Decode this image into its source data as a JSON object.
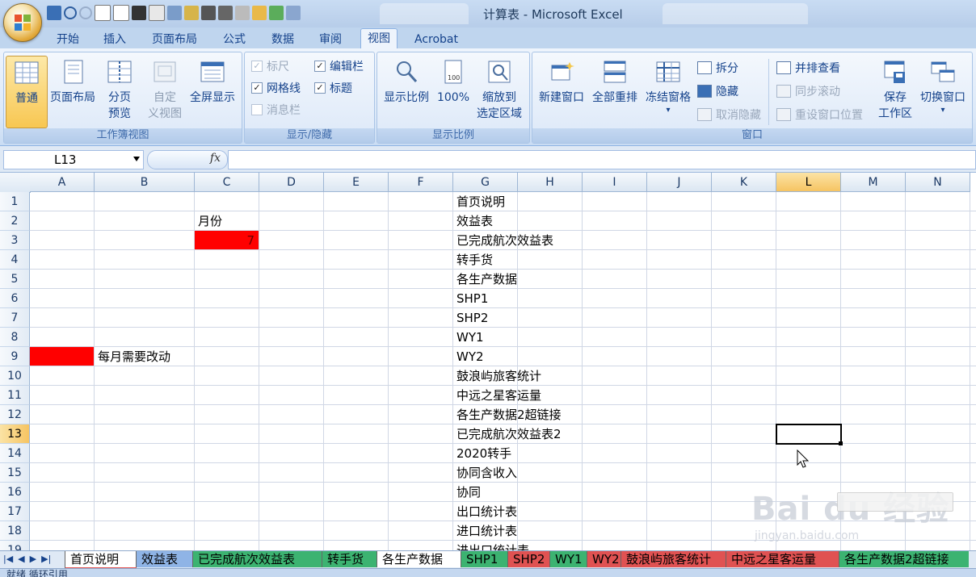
{
  "window": {
    "title": "计算表 - Microsoft Excel"
  },
  "ribbon_tabs": [
    {
      "label": "开始"
    },
    {
      "label": "插入"
    },
    {
      "label": "页面布局"
    },
    {
      "label": "公式"
    },
    {
      "label": "数据"
    },
    {
      "label": "审阅"
    },
    {
      "label": "视图",
      "active": true
    },
    {
      "label": "Acrobat"
    }
  ],
  "groups": {
    "workbook_views": {
      "label": "工作簿视图",
      "normal": "普通",
      "page_layout": "页面布局",
      "page_break_1": "分页",
      "page_break_2": "预览",
      "custom_1": "自定",
      "custom_2": "义视图",
      "fullscreen": "全屏显示"
    },
    "show_hide": {
      "label": "显示/隐藏",
      "ruler": "标尺",
      "formula_bar": "编辑栏",
      "gridlines": "网格线",
      "headings": "标题",
      "message_bar": "消息栏"
    },
    "zoom": {
      "label": "显示比例",
      "zoom": "显示比例",
      "hundred": "100%",
      "zoom_sel_1": "缩放到",
      "zoom_sel_2": "选定区域",
      "icon_100": "100"
    },
    "window": {
      "label": "窗口",
      "new_window": "新建窗口",
      "arrange_all": "全部重排",
      "freeze_panes": "冻结窗格",
      "split": "拆分",
      "hide": "隐藏",
      "unhide": "取消隐藏",
      "side_by_side": "并排查看",
      "sync_scroll": "同步滚动",
      "reset_position": "重设窗口位置",
      "save_ws_1": "保存",
      "save_ws_2": "工作区",
      "switch_window": "切换窗口",
      "dropdown_arrow": "▾"
    }
  },
  "formula_bar": {
    "name_box": "L13",
    "fx": "fx",
    "value": ""
  },
  "columns": [
    "A",
    "B",
    "C",
    "D",
    "E",
    "F",
    "G",
    "H",
    "I",
    "J",
    "K",
    "L",
    "M",
    "N"
  ],
  "rows": [
    "1",
    "2",
    "3",
    "4",
    "5",
    "6",
    "7",
    "8",
    "9",
    "10",
    "11",
    "12",
    "13",
    "14",
    "15",
    "16",
    "17",
    "18",
    "19"
  ],
  "selected_cell": "L13",
  "cells": {
    "C2": "月份",
    "C3": "7",
    "B9": "每月需要改动",
    "G1": "首页说明",
    "G2": "效益表",
    "G3": "已完成航次效益表",
    "G4": "转手货",
    "G5": "各生产数据",
    "G6": "SHP1",
    "G7": "SHP2",
    "G8": "WY1",
    "G9": "WY2",
    "G10": "鼓浪屿旅客统计",
    "G11": "中远之星客运量",
    "G12": "各生产数据2超链接",
    "G13": "已完成航次效益表2",
    "G14": "2020转手",
    "G15": "协同含收入",
    "G16": "协同",
    "G17": "出口统计表",
    "G18": "进口统计表",
    "G19": "进出口统计表"
  },
  "fill_color": "#FF0000",
  "sheet_tabs": [
    {
      "label": "首页说明",
      "color": "#e05252",
      "active": true
    },
    {
      "label": "效益表",
      "color": "#8fb4e6"
    },
    {
      "label": "已完成航次效益表",
      "color": "#3cb371"
    },
    {
      "label": "转手货",
      "color": "#3cb371"
    },
    {
      "label": "各生产数据",
      "color": "#ffffff"
    },
    {
      "label": "SHP1",
      "color": "#3cb371"
    },
    {
      "label": "SHP2",
      "color": "#e05252"
    },
    {
      "label": "WY1",
      "color": "#3cb371"
    },
    {
      "label": "WY2",
      "color": "#e05252"
    },
    {
      "label": "鼓浪屿旅客统计",
      "color": "#e05252"
    },
    {
      "label": "中远之星客运量",
      "color": "#e05252"
    },
    {
      "label": "各生产数据2超链接",
      "color": "#3cb371"
    }
  ],
  "status": {
    "text": "就绪 循环引用"
  },
  "watermark": {
    "main": "Bai du 经验",
    "sub": "jingyan.baidu.com"
  }
}
